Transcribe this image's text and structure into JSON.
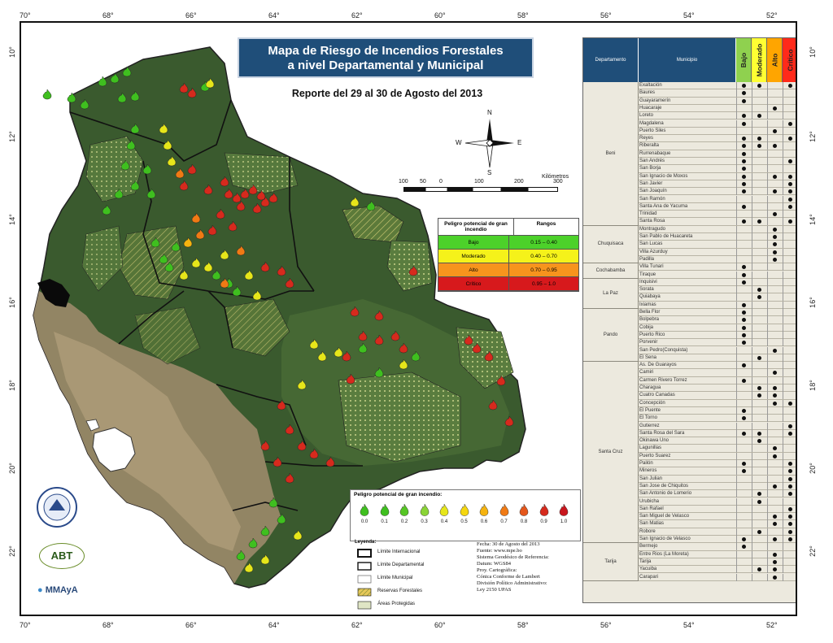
{
  "axis": {
    "lon_labels": [
      "70°",
      "68°",
      "66°",
      "64°",
      "62°",
      "60°",
      "58°",
      "56°",
      "54°",
      "52°"
    ],
    "lat_labels": [
      "10°",
      "12°",
      "14°",
      "16°",
      "18°",
      "20°",
      "22°"
    ]
  },
  "title": {
    "line1": "Mapa de Riesgo de Incendios Forestales",
    "line2": "a nivel Departamental y Municipal"
  },
  "report_date": "Reporte del 29 al 30 de Agosto del 2013",
  "north_arrow": {
    "n": "N",
    "s": "S",
    "e": "E",
    "w": "W"
  },
  "scale_bar": {
    "unit": "Kilómetros",
    "ticks": [
      "100",
      "50",
      "0",
      "100",
      "200",
      "300"
    ]
  },
  "risk_legend": {
    "col1": "Peligro potencial de gran incendio",
    "col2": "Rangos",
    "rows": [
      {
        "label": "Bajo",
        "range": "0.15 – 0.40",
        "color": "#4cd12a"
      },
      {
        "label": "Moderado",
        "range": "0.40 – 0.70",
        "color": "#f5f21a"
      },
      {
        "label": "Alto",
        "range": "0.70 – 0.95",
        "color": "#f7941d"
      },
      {
        "label": "Crítico",
        "range": "0.95 – 1.0",
        "color": "#d7191c"
      }
    ]
  },
  "danger_scale": {
    "title": "Peligro potencial de gran incendio:",
    "values": [
      "0.0",
      "0.1",
      "0.2",
      "0.3",
      "0.4",
      "0.5",
      "0.6",
      "0.7",
      "0.8",
      "0.9",
      "1.0"
    ],
    "colors": [
      "#3fbf1f",
      "#3fbf1f",
      "#56c624",
      "#8ad436",
      "#e6e61a",
      "#f5d70f",
      "#f5b30f",
      "#f07a14",
      "#e4561b",
      "#d62a1d",
      "#c8161d"
    ]
  },
  "legend": {
    "title": "Leyenda:",
    "items": [
      "Límite Internacional",
      "Límite Departamental",
      "Límite Municipal",
      "Reservas Forestales",
      "Áreas Protegidas"
    ]
  },
  "metadata": [
    "Fecha: 30 de Agosto del 2013",
    "Fuente: www.mpe.bo",
    "Sistema Geodésico de Referencia:",
    "Datum: WGS84",
    "Proy. Cartográfica:",
    "Cónica Conforme de Lambert",
    "División Político Administrativo:",
    "Ley 2150 UPAS"
  ],
  "logos": {
    "abt": "ABT",
    "mmaya": "MMAyA"
  },
  "table": {
    "headers": {
      "dept": "Departamento",
      "mun": "Municipio",
      "bajo": "Bajo",
      "moderado": "Moderado",
      "alto": "Alto",
      "critico": "Crítico"
    },
    "header_colors": {
      "bajo": "#8fd14f",
      "moderado": "#ffff33",
      "alto": "#ffa500",
      "critico": "#ff2a1a",
      "title": "#1f4e79"
    },
    "departments": [
      {
        "name": "Beni",
        "rows": [
          {
            "m": "Exaltación",
            "v": [
              1,
              1,
              0,
              1
            ]
          },
          {
            "m": "Baures",
            "v": [
              1,
              0,
              0,
              0
            ]
          },
          {
            "m": "Guayaramerín",
            "v": [
              1,
              0,
              0,
              0
            ]
          },
          {
            "m": "Huacaraje",
            "v": [
              0,
              0,
              1,
              0
            ]
          },
          {
            "m": "Loreto",
            "v": [
              1,
              1,
              0,
              0
            ]
          },
          {
            "m": "Magdalena",
            "v": [
              1,
              0,
              0,
              1
            ]
          },
          {
            "m": "Puerto Siles",
            "v": [
              0,
              0,
              1,
              0
            ]
          },
          {
            "m": "Reyes",
            "v": [
              1,
              1,
              0,
              1
            ]
          },
          {
            "m": "Riberalta",
            "v": [
              1,
              1,
              1,
              0
            ]
          },
          {
            "m": "Rurrenabaque",
            "v": [
              1,
              0,
              0,
              0
            ]
          },
          {
            "m": "San Andrés",
            "v": [
              1,
              0,
              0,
              1
            ]
          },
          {
            "m": "San Borja",
            "v": [
              1,
              0,
              0,
              0
            ]
          },
          {
            "m": "San Ignacio de Moxos",
            "v": [
              1,
              0,
              1,
              1
            ]
          },
          {
            "m": "San Javier",
            "v": [
              1,
              0,
              0,
              1
            ]
          },
          {
            "m": "San Joaquín",
            "v": [
              1,
              0,
              1,
              1
            ]
          },
          {
            "m": "San Ramón",
            "v": [
              0,
              0,
              0,
              1
            ]
          },
          {
            "m": "Santa Ana de Yacuma",
            "v": [
              1,
              0,
              0,
              1
            ]
          },
          {
            "m": "Trinidad",
            "v": [
              0,
              0,
              1,
              0
            ]
          },
          {
            "m": "Santa Rosa",
            "v": [
              1,
              1,
              0,
              1
            ]
          }
        ]
      },
      {
        "name": "Chuquisaca",
        "rows": [
          {
            "m": "Montragudo",
            "v": [
              0,
              0,
              1,
              0
            ]
          },
          {
            "m": "San Pablo de Huacareta",
            "v": [
              0,
              0,
              1,
              0
            ]
          },
          {
            "m": "San Lucas",
            "v": [
              0,
              0,
              1,
              0
            ]
          },
          {
            "m": "Villa Azurduy",
            "v": [
              0,
              0,
              1,
              0
            ]
          },
          {
            "m": "Padilla",
            "v": [
              0,
              0,
              1,
              0
            ]
          }
        ]
      },
      {
        "name": "Cochabamba",
        "rows": [
          {
            "m": "Villa Tunari",
            "v": [
              1,
              0,
              0,
              0
            ]
          },
          {
            "m": "Tiraque",
            "v": [
              1,
              0,
              0,
              0
            ]
          }
        ]
      },
      {
        "name": "La Paz",
        "rows": [
          {
            "m": "Inquisivi",
            "v": [
              1,
              0,
              0,
              0
            ]
          },
          {
            "m": "Sorata",
            "v": [
              0,
              1,
              0,
              0
            ]
          },
          {
            "m": "Quiabaya",
            "v": [
              0,
              1,
              0,
              0
            ]
          },
          {
            "m": "Ixiamas",
            "v": [
              1,
              0,
              0,
              0
            ]
          }
        ]
      },
      {
        "name": "Pando",
        "rows": [
          {
            "m": "Bella Flor",
            "v": [
              1,
              0,
              0,
              0
            ]
          },
          {
            "m": "Bolpebra",
            "v": [
              1,
              0,
              0,
              0
            ]
          },
          {
            "m": "Cobija",
            "v": [
              1,
              0,
              0,
              0
            ]
          },
          {
            "m": "Puerto Rico",
            "v": [
              1,
              0,
              0,
              0
            ]
          },
          {
            "m": "Porvenir",
            "v": [
              1,
              0,
              0,
              0
            ]
          },
          {
            "m": "San Pedro(Conquista)",
            "v": [
              0,
              0,
              1,
              0
            ]
          },
          {
            "m": "El Sena",
            "v": [
              0,
              1,
              0,
              0
            ]
          }
        ]
      },
      {
        "name": "Santa Cruz",
        "rows": [
          {
            "m": "As. De Guarayos",
            "v": [
              1,
              0,
              0,
              0
            ]
          },
          {
            "m": "Camiri",
            "v": [
              0,
              0,
              1,
              0
            ]
          },
          {
            "m": "Carmen Rivero Torrez",
            "v": [
              1,
              0,
              0,
              0
            ]
          },
          {
            "m": "Charagua",
            "v": [
              0,
              1,
              1,
              0
            ]
          },
          {
            "m": "Cuatro Canadas",
            "v": [
              0,
              1,
              1,
              0
            ]
          },
          {
            "m": "Concepción",
            "v": [
              0,
              0,
              1,
              1
            ]
          },
          {
            "m": "El Puente",
            "v": [
              1,
              0,
              0,
              0
            ]
          },
          {
            "m": "El Torno",
            "v": [
              1,
              0,
              0,
              0
            ]
          },
          {
            "m": "Gutierrez",
            "v": [
              0,
              0,
              0,
              1
            ]
          },
          {
            "m": "Santa Rosa del Sara",
            "v": [
              1,
              1,
              0,
              1
            ]
          },
          {
            "m": "Okinawa Uno",
            "v": [
              0,
              1,
              0,
              0
            ]
          },
          {
            "m": "Lagunillas",
            "v": [
              0,
              0,
              1,
              0
            ]
          },
          {
            "m": "Puerto Suarez",
            "v": [
              0,
              0,
              1,
              0
            ]
          },
          {
            "m": "Pailón",
            "v": [
              1,
              0,
              0,
              1
            ]
          },
          {
            "m": "Mineros",
            "v": [
              1,
              0,
              0,
              1
            ]
          },
          {
            "m": "San Julian",
            "v": [
              0,
              0,
              0,
              1
            ]
          },
          {
            "m": "San Jose de Chiquitos",
            "v": [
              0,
              0,
              1,
              1
            ]
          },
          {
            "m": "San Antonio de Lomerio",
            "v": [
              0,
              1,
              0,
              1
            ]
          },
          {
            "m": "Urubicha",
            "v": [
              0,
              1,
              0,
              0
            ]
          },
          {
            "m": "San Rafael",
            "v": [
              0,
              0,
              0,
              1
            ]
          },
          {
            "m": "San Miguel de Velasco",
            "v": [
              0,
              0,
              1,
              1
            ]
          },
          {
            "m": "San Matias",
            "v": [
              0,
              0,
              1,
              1
            ]
          },
          {
            "m": "Robore",
            "v": [
              0,
              1,
              0,
              1
            ]
          },
          {
            "m": "San Ignacio de Velasco",
            "v": [
              1,
              0,
              1,
              1
            ]
          }
        ]
      },
      {
        "name": "Tarija",
        "rows": [
          {
            "m": "Bermejo",
            "v": [
              1,
              0,
              0,
              0
            ]
          },
          {
            "m": "Entre Rios (La Moreta)",
            "v": [
              0,
              0,
              1,
              0
            ]
          },
          {
            "m": "Tarija",
            "v": [
              0,
              0,
              1,
              0
            ]
          },
          {
            "m": "Yacuiba",
            "v": [
              0,
              1,
              1,
              0
            ]
          },
          {
            "m": "Carapari",
            "v": [
              0,
              0,
              1,
              0
            ]
          }
        ]
      }
    ]
  }
}
